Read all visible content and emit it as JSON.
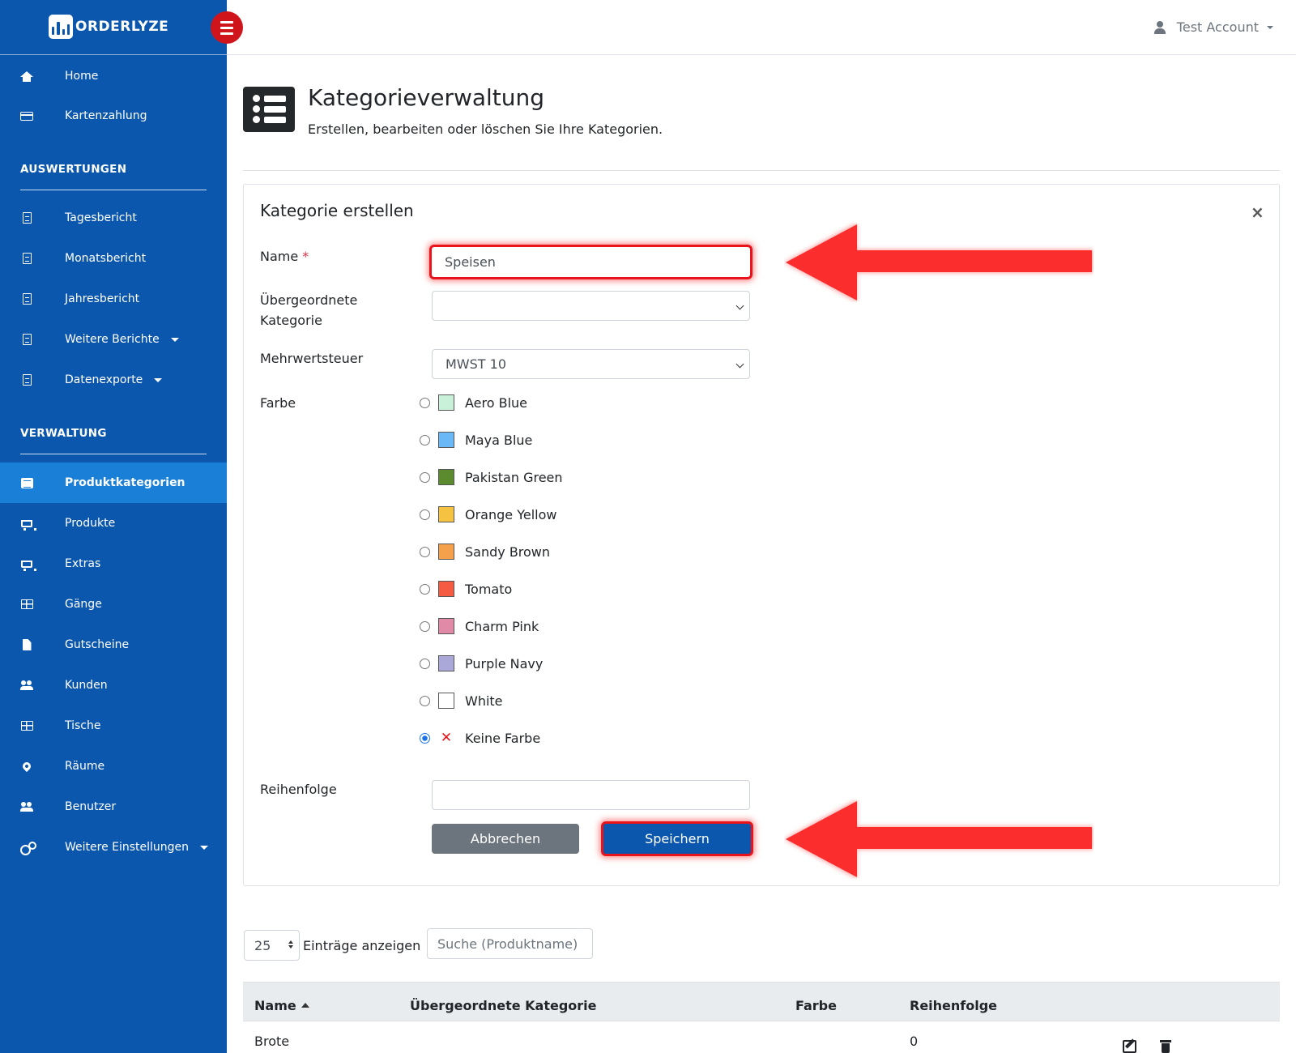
{
  "app": {
    "logo_text": "ORDERLYZE",
    "account_name": "Test Account"
  },
  "sidebar": {
    "top_items": [
      {
        "label": "Home",
        "icon": "home-icon"
      },
      {
        "label": "Kartenzahlung",
        "icon": "credit-card-icon"
      }
    ],
    "sections": [
      {
        "title": "AUSWERTUNGEN",
        "items": [
          {
            "label": "Tagesbericht",
            "icon": "document-icon"
          },
          {
            "label": "Monatsbericht",
            "icon": "document-icon"
          },
          {
            "label": "Jahresbericht",
            "icon": "document-icon"
          },
          {
            "label": "Weitere Berichte",
            "icon": "document-icon",
            "dropdown": true
          },
          {
            "label": "Datenexporte",
            "icon": "document-icon",
            "dropdown": true
          }
        ]
      },
      {
        "title": "VERWALTUNG",
        "items": [
          {
            "label": "Produktkategorien",
            "icon": "list-icon",
            "active": true
          },
          {
            "label": "Produkte",
            "icon": "cart-icon"
          },
          {
            "label": "Extras",
            "icon": "cart-plus-icon"
          },
          {
            "label": "Gänge",
            "icon": "table-icon"
          },
          {
            "label": "Gutscheine",
            "icon": "file-icon"
          },
          {
            "label": "Kunden",
            "icon": "users-icon"
          },
          {
            "label": "Tische",
            "icon": "table-icon"
          },
          {
            "label": "Räume",
            "icon": "map-pin-icon"
          },
          {
            "label": "Benutzer",
            "icon": "users-icon"
          },
          {
            "label": "Weitere Einstellungen",
            "icon": "gears-icon",
            "dropdown": true
          }
        ]
      }
    ]
  },
  "header": {
    "title": "Kategorieverwaltung",
    "subtitle": "Erstellen, bearbeiten oder löschen Sie Ihre Kategorien."
  },
  "form": {
    "card_title": "Kategorie erstellen",
    "close_label": "×",
    "name_label": "Name",
    "required_marker": "*",
    "name_value": "Speisen",
    "parent_label_line1": "Übergeordnete",
    "parent_label_line2": "Kategorie",
    "parent_value": "",
    "vat_label": "Mehrwertsteuer",
    "vat_value": "MWST 10",
    "color_label": "Farbe",
    "colors": [
      {
        "name": "Aero Blue",
        "hex": "#c9f0d8",
        "checked": false
      },
      {
        "name": "Maya Blue",
        "hex": "#6ab8f5",
        "checked": false
      },
      {
        "name": "Pakistan Green",
        "hex": "#5c8a2e",
        "checked": false
      },
      {
        "name": "Orange Yellow",
        "hex": "#f5c242",
        "checked": false
      },
      {
        "name": "Sandy Brown",
        "hex": "#f5a04a",
        "checked": false
      },
      {
        "name": "Tomato",
        "hex": "#f55a42",
        "checked": false
      },
      {
        "name": "Charm Pink",
        "hex": "#e08aa8",
        "checked": false
      },
      {
        "name": "Purple Navy",
        "hex": "#aaa8d8",
        "checked": false
      },
      {
        "name": "White",
        "hex": "#ffffff",
        "checked": false
      },
      {
        "name": "Keine Farbe",
        "hex": "",
        "checked": true,
        "none": true
      }
    ],
    "order_label": "Reihenfolge",
    "order_value": "",
    "cancel_label": "Abbrechen",
    "save_label": "Speichern",
    "highlight_color": "#e8131b"
  },
  "table_controls": {
    "page_length": "25",
    "page_length_label": "Einträge anzeigen",
    "search_placeholder": "Suche (Produktname)"
  },
  "table": {
    "columns": [
      "Name",
      "Übergeordnete Kategorie",
      "Farbe",
      "Reihenfolge"
    ],
    "rows": [
      {
        "name": "Brote",
        "parent": "",
        "color": "",
        "order": "0"
      }
    ]
  }
}
